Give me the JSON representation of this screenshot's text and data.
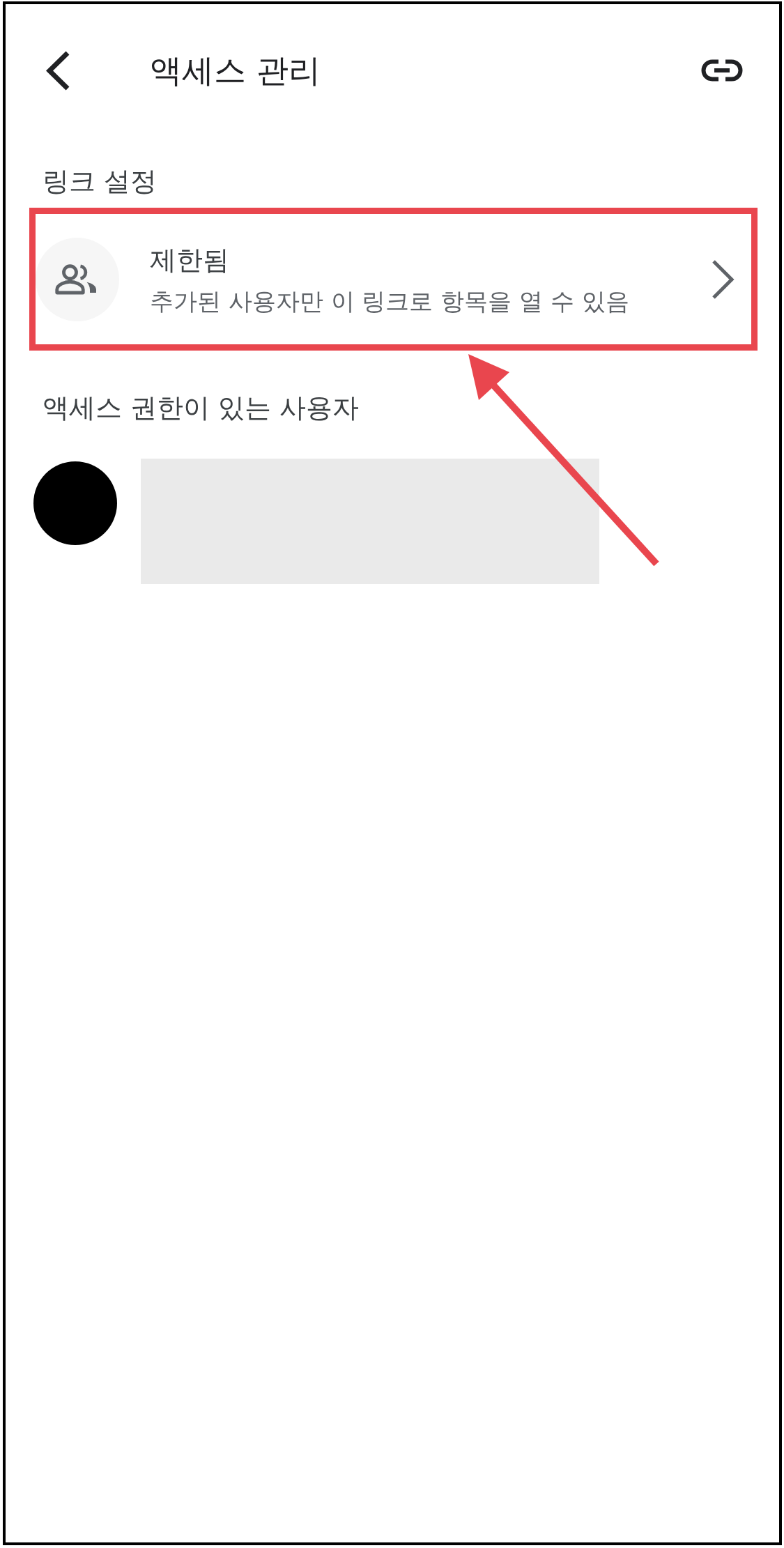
{
  "header": {
    "title": "액세스 관리"
  },
  "link_settings": {
    "heading": "링크 설정",
    "option": {
      "title": "제한됨",
      "description": "추가된 사용자만 이 링크로 항목을 열 수 있음",
      "highlighted": true
    }
  },
  "people": {
    "heading": "액세스 권한이 있는 사용자"
  }
}
